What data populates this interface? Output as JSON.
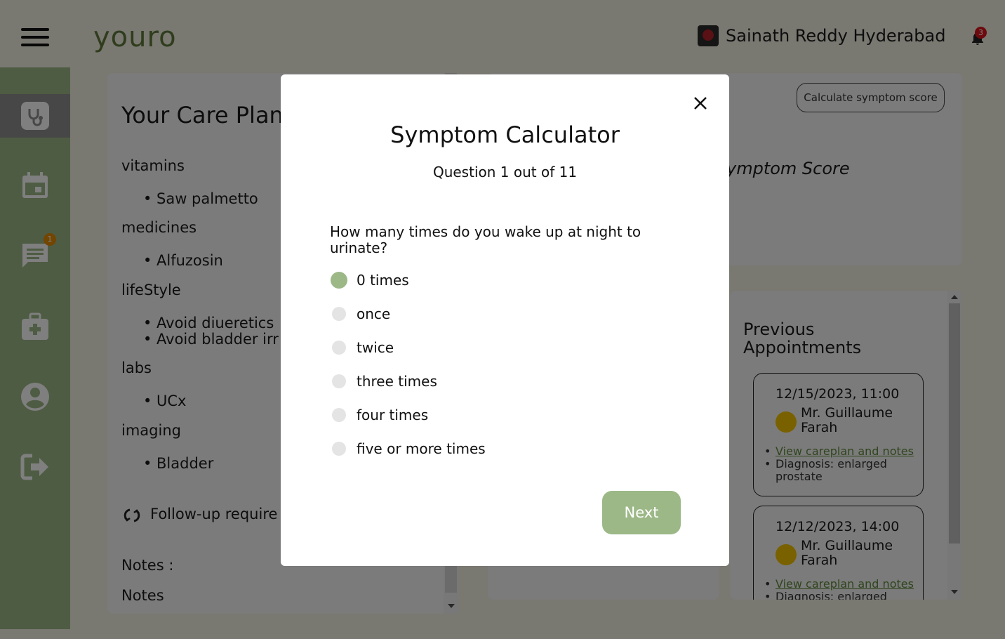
{
  "header": {
    "logo": "youro",
    "user_name": "Sainath Reddy Hyderabad",
    "notification_count": "3"
  },
  "sidebar": {
    "items": [
      {
        "icon": "stethoscope-icon",
        "active": true
      },
      {
        "icon": "calendar-icon"
      },
      {
        "icon": "chat-icon",
        "badge": "1"
      },
      {
        "icon": "medical-kit-icon"
      },
      {
        "icon": "profile-icon"
      },
      {
        "icon": "logout-icon"
      }
    ]
  },
  "care_plan": {
    "title": "Your Care Plan",
    "categories": [
      {
        "name": "vitamins",
        "items": [
          "Saw palmetto"
        ]
      },
      {
        "name": "medicines",
        "items": [
          "Alfuzosin"
        ]
      },
      {
        "name": "lifeStyle",
        "items": [
          "Avoid diueretics",
          "Avoid bladder irr"
        ]
      },
      {
        "name": "labs",
        "items": [
          "UCx"
        ]
      },
      {
        "name": "imaging",
        "items": [
          "Bladder"
        ]
      }
    ],
    "follow_up": "Follow-up require",
    "notes_label": "Notes :",
    "notes_value": "Notes"
  },
  "score_panel": {
    "calc_button": "Calculate symptom score",
    "score_label": "ymptom Score"
  },
  "previous_appointments": {
    "title": "Previous Appointments",
    "items": [
      {
        "datetime": "12/15/2023, 11:00",
        "doctor": "Mr. Guillaume Farah",
        "link": "View careplan and notes",
        "diagnosis": "Diagnosis: enlarged prostate"
      },
      {
        "datetime": "12/12/2023, 14:00",
        "doctor": "Mr. Guillaume Farah",
        "link": "View careplan and notes",
        "diagnosis": "Diagnosis: enlarged"
      }
    ]
  },
  "modal": {
    "title": "Symptom Calculator",
    "subtitle": "Question 1 out of 11",
    "question": "How many times do you wake up at night to urinate?",
    "options": [
      "0 times",
      "once",
      "twice",
      "three times",
      "four times",
      "five or more times"
    ],
    "selected_index": 0,
    "next_label": "Next"
  },
  "colors": {
    "accent": "#9cb887",
    "logo": "#5f7a3a",
    "badge_red": "#d8141c",
    "badge_orange": "#e58a00"
  }
}
